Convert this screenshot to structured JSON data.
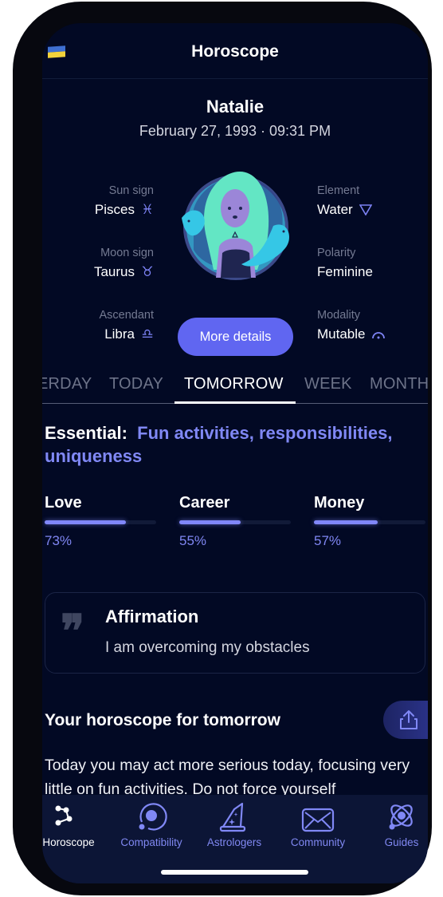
{
  "header": {
    "title": "Horoscope",
    "flag": "ukraine-flag"
  },
  "profile": {
    "name": "Natalie",
    "birth": "February 27, 1993 · 09:31 PM"
  },
  "attributes": {
    "left": [
      {
        "label": "Sun sign",
        "value": "Pisces",
        "symbol": "♓︎",
        "icon": "pisces-icon"
      },
      {
        "label": "Moon sign",
        "value": "Taurus",
        "symbol": "♉︎",
        "icon": "taurus-icon"
      },
      {
        "label": "Ascendant",
        "value": "Libra",
        "symbol": "♎︎",
        "icon": "libra-icon"
      }
    ],
    "right": [
      {
        "label": "Element",
        "value": "Water",
        "symbol": "▽",
        "icon": "water-triangle-icon"
      },
      {
        "label": "Polarity",
        "value": "Feminine"
      },
      {
        "label": "Modality",
        "value": "Mutable",
        "icon": "mutable-icon"
      }
    ]
  },
  "more_details_label": "More details",
  "tabs": [
    {
      "label": "YESTERDAY",
      "visible_text": "ERDAY"
    },
    {
      "label": "TODAY"
    },
    {
      "label": "TOMORROW",
      "active": true
    },
    {
      "label": "WEEK"
    },
    {
      "label": "MONTH"
    }
  ],
  "essential": {
    "label": "Essential:",
    "value": "Fun activities, responsibilities, uniqueness"
  },
  "meters": [
    {
      "name": "Love",
      "percent": 73,
      "percent_label": "73%"
    },
    {
      "name": "Career",
      "percent": 55,
      "percent_label": "55%"
    },
    {
      "name": "Money",
      "percent": 57,
      "percent_label": "57%"
    }
  ],
  "affirmation": {
    "quote_glyph": "❞",
    "title": "Affirmation",
    "text": "I am overcoming my obstacles"
  },
  "horoscope": {
    "title": "Your horoscope for tomorrow",
    "body": "Today you may act more serious today, focusing very little on fun activities. Do not force yourself"
  },
  "nav": [
    {
      "label": "Horoscope",
      "icon": "constellation-icon",
      "active": true
    },
    {
      "label": "Compatibility",
      "icon": "compatibility-orbit-icon"
    },
    {
      "label": "Astrologers",
      "icon": "wizard-hat-icon"
    },
    {
      "label": "Community",
      "icon": "envelope-icon"
    },
    {
      "label": "Guides",
      "icon": "atom-icon"
    }
  ],
  "colors": {
    "background": "#020924",
    "accent": "#6066f1",
    "accent_text": "#8088f5",
    "nav_bg": "#0c1536"
  }
}
